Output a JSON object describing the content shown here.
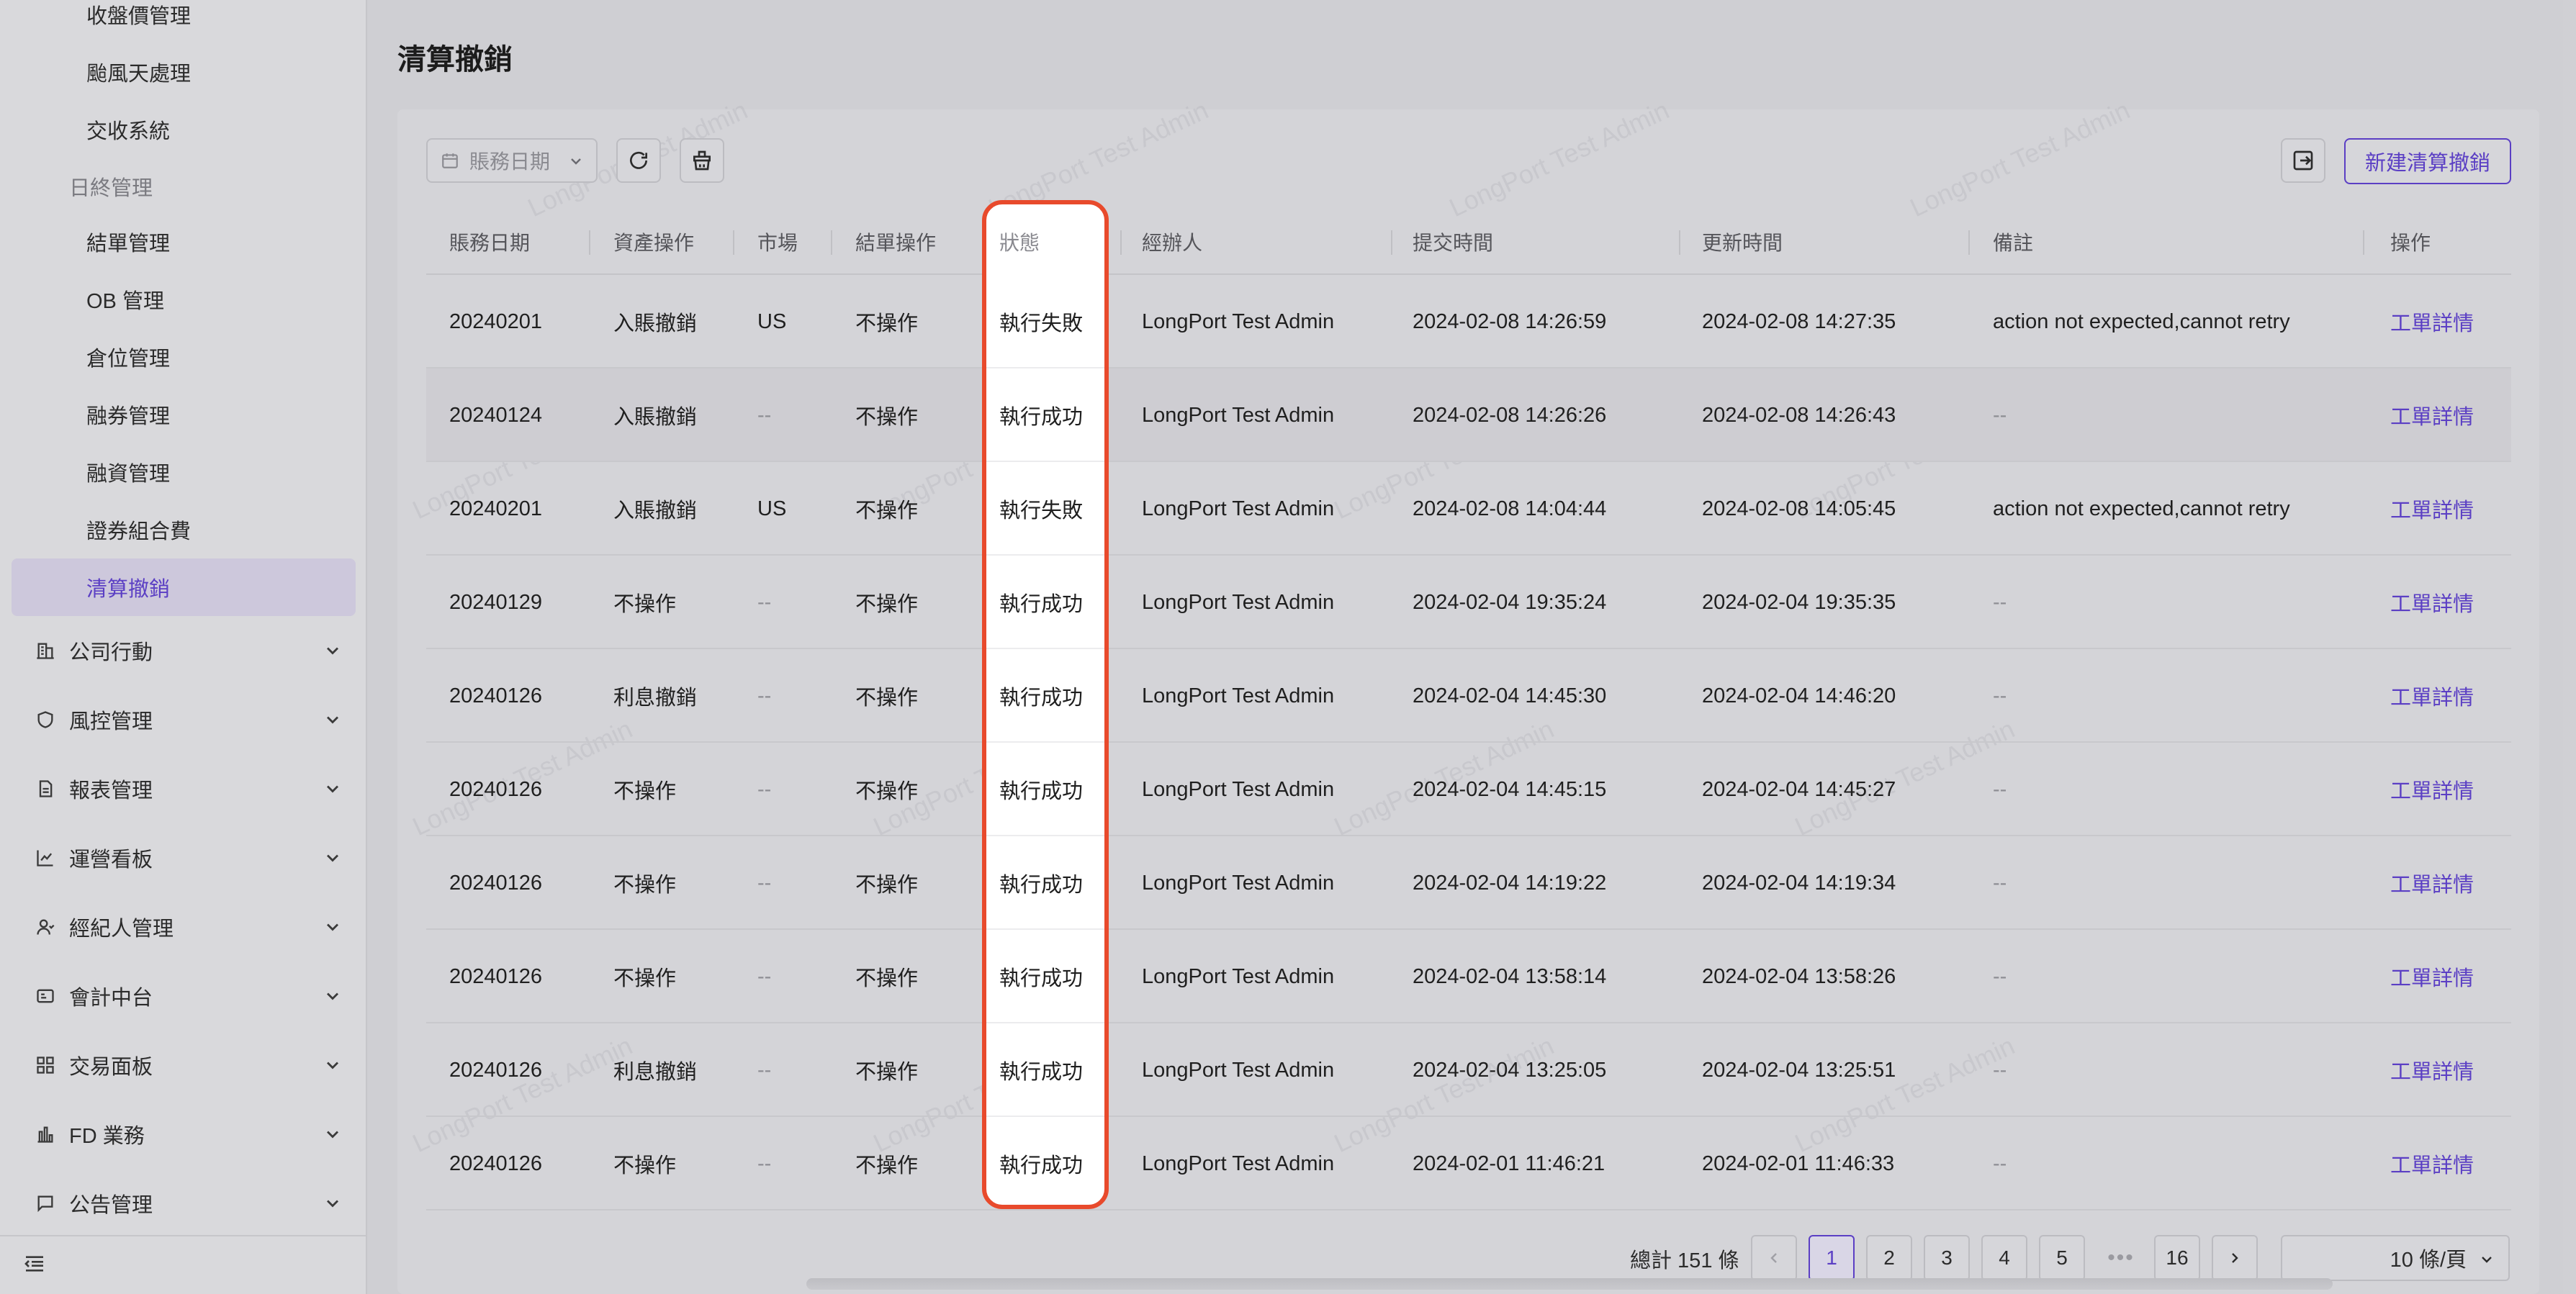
{
  "sidebar": {
    "items": [
      {
        "label": "收盤價管理"
      },
      {
        "label": "颱風天處理"
      },
      {
        "label": "交收系統"
      },
      {
        "label": "日終管理"
      },
      {
        "label": "結單管理"
      },
      {
        "label": "OB 管理"
      },
      {
        "label": "倉位管理"
      },
      {
        "label": "融券管理"
      },
      {
        "label": "融資管理"
      },
      {
        "label": "證券組合費"
      },
      {
        "label": "清算撤銷"
      }
    ],
    "groups": [
      {
        "label": "公司行動",
        "icon": "building-icon"
      },
      {
        "label": "風控管理",
        "icon": "shield-icon"
      },
      {
        "label": "報表管理",
        "icon": "report-icon"
      },
      {
        "label": "運營看板",
        "icon": "chart-icon"
      },
      {
        "label": "經紀人管理",
        "icon": "user-icon"
      },
      {
        "label": "會計中台",
        "icon": "ledger-icon"
      },
      {
        "label": "交易面板",
        "icon": "grid-icon"
      },
      {
        "label": "FD 業務",
        "icon": "bank-icon"
      },
      {
        "label": "公告管理",
        "icon": "message-icon"
      }
    ]
  },
  "page": {
    "title": "清算撤銷"
  },
  "toolbar": {
    "date_placeholder": "賬務日期",
    "new_button": "新建清算撤銷"
  },
  "table": {
    "headers": [
      "賬務日期",
      "資產操作",
      "市場",
      "結單操作",
      "狀態",
      "經辦人",
      "提交時間",
      "更新時間",
      "備註",
      "操作"
    ],
    "rows": [
      {
        "date": "20240201",
        "asset_op": "入賬撤銷",
        "market": "US",
        "statement_op": "不操作",
        "status": "執行失敗",
        "handler": "LongPort Test Admin",
        "submitted": "2024-02-08 14:26:59",
        "updated": "2024-02-08 14:27:35",
        "remark": "action not expected,cannot retry",
        "action": "工單詳情"
      },
      {
        "date": "20240124",
        "asset_op": "入賬撤銷",
        "market": "--",
        "statement_op": "不操作",
        "status": "執行成功",
        "handler": "LongPort Test Admin",
        "submitted": "2024-02-08 14:26:26",
        "updated": "2024-02-08 14:26:43",
        "remark": "--",
        "action": "工單詳情"
      },
      {
        "date": "20240201",
        "asset_op": "入賬撤銷",
        "market": "US",
        "statement_op": "不操作",
        "status": "執行失敗",
        "handler": "LongPort Test Admin",
        "submitted": "2024-02-08 14:04:44",
        "updated": "2024-02-08 14:05:45",
        "remark": "action not expected,cannot retry",
        "action": "工單詳情"
      },
      {
        "date": "20240129",
        "asset_op": "不操作",
        "market": "--",
        "statement_op": "不操作",
        "status": "執行成功",
        "handler": "LongPort Test Admin",
        "submitted": "2024-02-04 19:35:24",
        "updated": "2024-02-04 19:35:35",
        "remark": "--",
        "action": "工單詳情"
      },
      {
        "date": "20240126",
        "asset_op": "利息撤銷",
        "market": "--",
        "statement_op": "不操作",
        "status": "執行成功",
        "handler": "LongPort Test Admin",
        "submitted": "2024-02-04 14:45:30",
        "updated": "2024-02-04 14:46:20",
        "remark": "--",
        "action": "工單詳情"
      },
      {
        "date": "20240126",
        "asset_op": "不操作",
        "market": "--",
        "statement_op": "不操作",
        "status": "執行成功",
        "handler": "LongPort Test Admin",
        "submitted": "2024-02-04 14:45:15",
        "updated": "2024-02-04 14:45:27",
        "remark": "--",
        "action": "工單詳情"
      },
      {
        "date": "20240126",
        "asset_op": "不操作",
        "market": "--",
        "statement_op": "不操作",
        "status": "執行成功",
        "handler": "LongPort Test Admin",
        "submitted": "2024-02-04 14:19:22",
        "updated": "2024-02-04 14:19:34",
        "remark": "--",
        "action": "工單詳情"
      },
      {
        "date": "20240126",
        "asset_op": "不操作",
        "market": "--",
        "statement_op": "不操作",
        "status": "執行成功",
        "handler": "LongPort Test Admin",
        "submitted": "2024-02-04 13:58:14",
        "updated": "2024-02-04 13:58:26",
        "remark": "--",
        "action": "工單詳情"
      },
      {
        "date": "20240126",
        "asset_op": "利息撤銷",
        "market": "--",
        "statement_op": "不操作",
        "status": "執行成功",
        "handler": "LongPort Test Admin",
        "submitted": "2024-02-04 13:25:05",
        "updated": "2024-02-04 13:25:51",
        "remark": "--",
        "action": "工單詳情"
      },
      {
        "date": "20240126",
        "asset_op": "不操作",
        "market": "--",
        "statement_op": "不操作",
        "status": "執行成功",
        "handler": "LongPort Test Admin",
        "submitted": "2024-02-01 11:46:21",
        "updated": "2024-02-01 11:46:33",
        "remark": "--",
        "action": "工單詳情"
      }
    ]
  },
  "pagination": {
    "total": "總計 151 條",
    "pages": [
      "1",
      "2",
      "3",
      "4",
      "5"
    ],
    "last_page": "16",
    "current": "1",
    "page_size": "10 條/頁",
    "dots": "•••"
  },
  "watermark": "LongPort Test Admin",
  "colors": {
    "accent": "#5b3fc4",
    "highlight": "#e84a2c"
  }
}
